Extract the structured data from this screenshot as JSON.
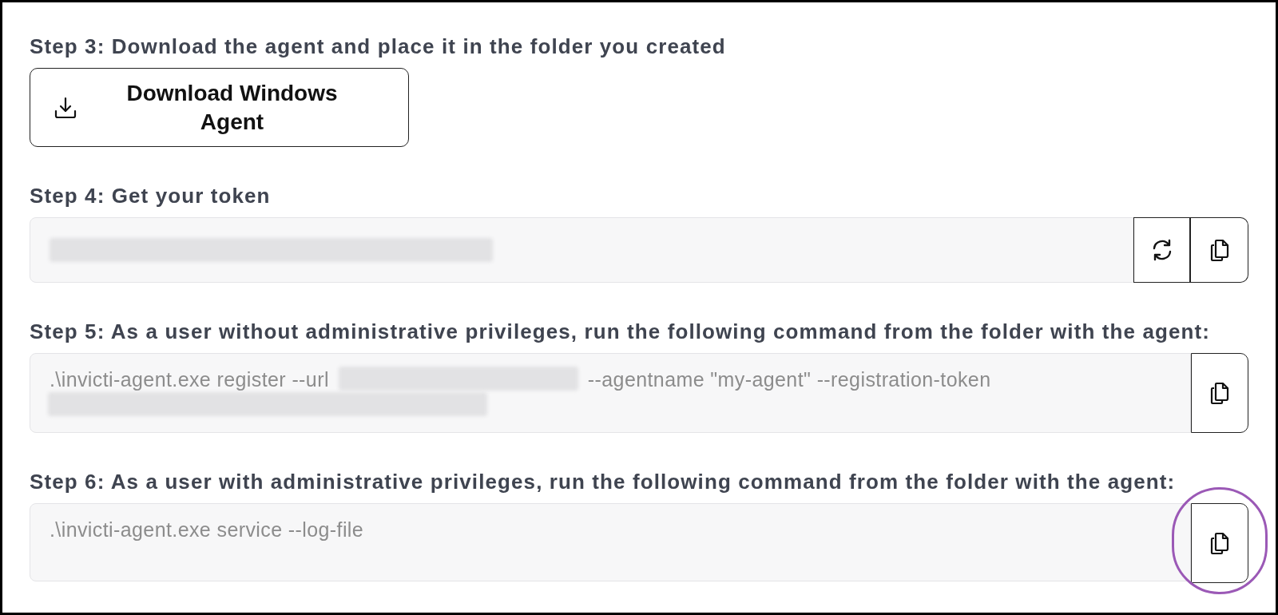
{
  "steps": [
    {
      "kind": "download",
      "heading": "Step 3: Download the agent and place it in the folder you created",
      "button": {
        "label": "Download Windows Agent"
      }
    },
    {
      "kind": "token",
      "heading": "Step 4: Get your token",
      "parts": [
        {
          "kind": "redacted"
        }
      ],
      "buttons": [
        {
          "kind": "refresh",
          "highlighted": false
        },
        {
          "kind": "copy",
          "highlighted": false
        }
      ]
    },
    {
      "kind": "command",
      "heading": "Step 5: As a user without administrative privileges, run the following command from the folder with the agent:",
      "parts": [
        {
          "kind": "text",
          "text": ".\\invicti-agent.exe register --url"
        },
        {
          "kind": "redacted"
        },
        {
          "kind": "text",
          "text": "--agentname \"my-agent\" --registration-token"
        },
        {
          "kind": "redacted"
        }
      ],
      "buttons": [
        {
          "kind": "copy",
          "highlighted": false
        }
      ]
    },
    {
      "kind": "command",
      "heading": "Step 6: As a user with administrative privileges, run the following command from the folder with the agent:",
      "parts": [
        {
          "kind": "text",
          "text": ".\\invicti-agent.exe service --log-file"
        }
      ],
      "buttons": [
        {
          "kind": "copy",
          "highlighted": true
        }
      ]
    }
  ]
}
